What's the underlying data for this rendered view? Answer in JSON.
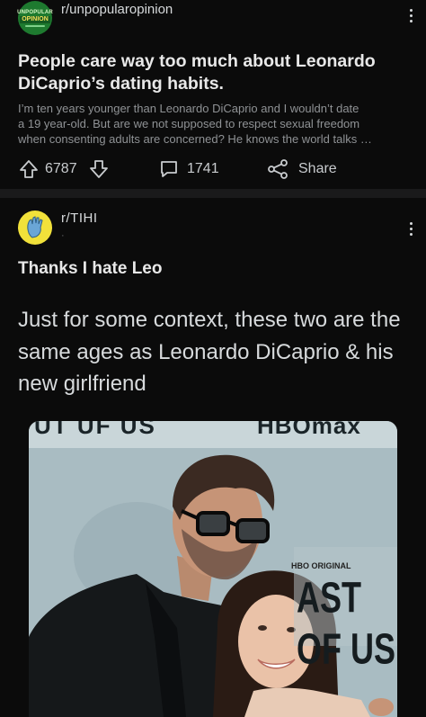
{
  "post1": {
    "subreddit": "r/unpopularopinion",
    "avatar": {
      "line1": "UNPOPULAR",
      "line2": "OPINION"
    },
    "title": "People care way too much about Leonardo DiCaprio’s dating habits.",
    "body": "I’m ten years younger than Leonardo DiCaprio and I wouldn’t date\na 19 year-old. But are we not supposed to respect sexual freedom\nwhen consenting adults are concerned?  He knows the world talks …",
    "votes": "6787",
    "comments": "1741",
    "share_label": "Share",
    "icons": {
      "upvote": "upvote-arrow-icon",
      "downvote": "downvote-arrow-icon",
      "comment": "comment-bubble-icon",
      "share": "share-nodes-icon",
      "more": "more-vertical-icon"
    }
  },
  "post2": {
    "subreddit": "r/TIHI",
    "meta": "·",
    "title": "Thanks I hate Leo",
    "tweet_text": "Just for some context, these two are the same ages as Leonardo DiCaprio & his new girlfriend",
    "photo": {
      "top_left_text": "UT UF US",
      "top_right_text": "HBOmax",
      "hbo_text": "HBO ORIGINAL",
      "logo_text": "AST OF US"
    },
    "avatar_icon": "tihi-hand-icon"
  },
  "colors": {
    "background": "#0b0b0b",
    "divider": "#1a1a1b",
    "text_primary": "#d7dadc",
    "text_secondary": "#8f9295",
    "unpopular_green": "#1e7a2f",
    "tihi_yellow": "#f1e13a"
  }
}
